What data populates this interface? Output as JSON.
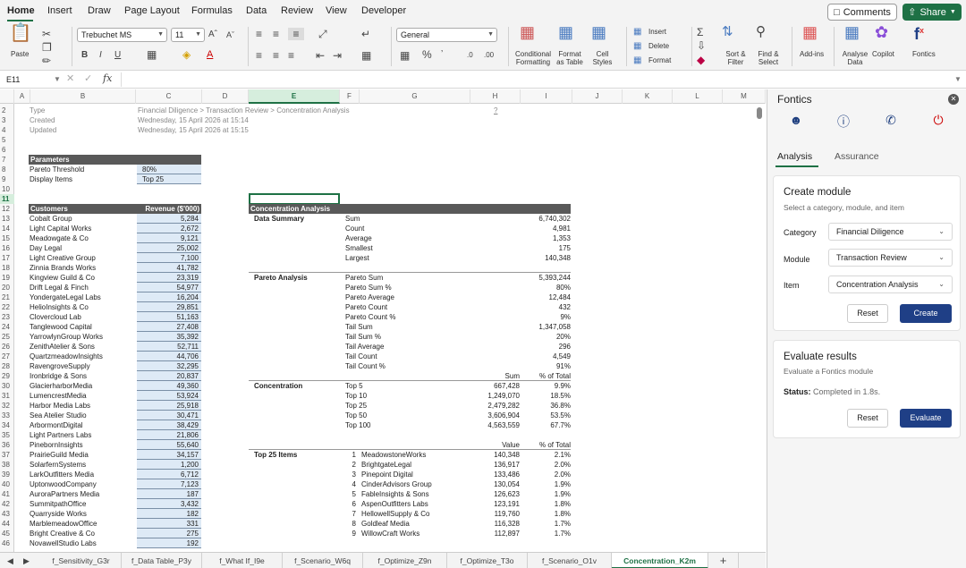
{
  "menu": {
    "items": [
      "Home",
      "Insert",
      "Draw",
      "Page Layout",
      "Formulas",
      "Data",
      "Review",
      "View",
      "Developer"
    ],
    "comments": "Comments",
    "share": "Share"
  },
  "ribbon": {
    "paste": "Paste",
    "font_name": "Trebuchet MS",
    "font_size": "11",
    "number_format": "General",
    "insert": "Insert",
    "delete": "Delete",
    "format": "Format",
    "conditional_formatting": "Conditional Formatting",
    "format_as_table": "Format as Table",
    "cell_styles": "Cell Styles",
    "sort_filter": "Sort & Filter",
    "find_select": "Find & Select",
    "add_ins": "Add-ins",
    "analyse_data": "Analyse Data",
    "copilot": "Copilot",
    "fontics": "Fontics"
  },
  "formula_bar": {
    "name_box": "E11",
    "fx": "fx",
    "value": ""
  },
  "columns": [
    "A",
    "B",
    "C",
    "D",
    "E",
    "F",
    "G",
    "H",
    "I",
    "J",
    "K",
    "L",
    "M"
  ],
  "selected_cell": "E11",
  "rows": [
    "2",
    "3",
    "4",
    "5",
    "6",
    "7",
    "8",
    "9",
    "10",
    "11",
    "12",
    "13",
    "14",
    "15",
    "16",
    "17",
    "18",
    "19",
    "20",
    "21",
    "22",
    "23",
    "24",
    "25",
    "26",
    "27",
    "28",
    "29",
    "30",
    "31",
    "32",
    "33",
    "34",
    "35",
    "36",
    "37",
    "38",
    "39",
    "40",
    "41",
    "42",
    "43",
    "44",
    "45",
    "46"
  ],
  "meta": {
    "type_label": "Type",
    "type_value": "Financial Diligence > Transaction Review > Concentration Analysis",
    "created_label": "Created",
    "created_value": "Wednesday, 15 April 2026 at 15:14",
    "updated_label": "Updated",
    "updated_value": "Wednesday, 15 April 2026 at 15:15",
    "help": "?"
  },
  "parameters": {
    "header": "Parameters",
    "rows": [
      {
        "label": "Pareto Threshold",
        "value": "80%"
      },
      {
        "label": "Display Items",
        "value": "Top 25"
      }
    ]
  },
  "customers": {
    "header": "Customers",
    "value_header": "Revenue ($'000)",
    "rows": [
      {
        "name": "Cobalt Group",
        "value": "5,284"
      },
      {
        "name": "Light Capital Works",
        "value": "2,672"
      },
      {
        "name": "Meadowgate & Co",
        "value": "9,121"
      },
      {
        "name": "Day Legal",
        "value": "25,002"
      },
      {
        "name": "Light Creative Group",
        "value": "7,100"
      },
      {
        "name": "Zinnia Brands Works",
        "value": "41,782"
      },
      {
        "name": "Kingview Guild & Co",
        "value": "23,319"
      },
      {
        "name": "Drift Legal & Finch",
        "value": "54,977"
      },
      {
        "name": "YondergateLegal Labs",
        "value": "16,204"
      },
      {
        "name": "HelioInsights & Co",
        "value": "29,851"
      },
      {
        "name": "Clovercloud Lab",
        "value": "51,163"
      },
      {
        "name": "Tanglewood Capital",
        "value": "27,408"
      },
      {
        "name": "YarrowlynGroup Works",
        "value": "35,392"
      },
      {
        "name": "ZenithAtelier & Sons",
        "value": "52,711"
      },
      {
        "name": "QuartzmeadowInsights",
        "value": "44,706"
      },
      {
        "name": "RavengroveSupply",
        "value": "32,295"
      },
      {
        "name": "Ironbridge & Sons",
        "value": "20,837"
      },
      {
        "name": "GlacierharborMedia",
        "value": "49,360"
      },
      {
        "name": "LumencrestMedia",
        "value": "53,924"
      },
      {
        "name": "Harbor Media Labs",
        "value": "25,918"
      },
      {
        "name": "Sea Atelier Studio",
        "value": "30,471"
      },
      {
        "name": "ArbormontDigital",
        "value": "38,429"
      },
      {
        "name": "Light Partners Labs",
        "value": "21,806"
      },
      {
        "name": "PinebornInsights",
        "value": "55,640"
      },
      {
        "name": "PrairieGuild Media",
        "value": "34,157"
      },
      {
        "name": "SolarfernSystems",
        "value": "1,200"
      },
      {
        "name": "LarkOutfitters Media",
        "value": "6,712"
      },
      {
        "name": "UptonwoodCompany",
        "value": "7,123"
      },
      {
        "name": "AuroraPartners Media",
        "value": "187"
      },
      {
        "name": "SummitpathOffice",
        "value": "3,432"
      },
      {
        "name": "Quarryside Works",
        "value": "182"
      },
      {
        "name": "MarblemeadowOffice",
        "value": "331"
      },
      {
        "name": "Bright Creative & Co",
        "value": "275"
      },
      {
        "name": "NovawellStudio Labs",
        "value": "192"
      }
    ]
  },
  "analysis": {
    "header": "Concentration Analysis",
    "data_summary": {
      "title": "Data Summary",
      "rows": [
        {
          "label": "Sum",
          "value": "6,740,302"
        },
        {
          "label": "Count",
          "value": "4,981"
        },
        {
          "label": "Average",
          "value": "1,353"
        },
        {
          "label": "Smallest",
          "value": "175"
        },
        {
          "label": "Largest",
          "value": "140,348"
        }
      ]
    },
    "pareto": {
      "title": "Pareto Analysis",
      "rows": [
        {
          "label": "Pareto Sum",
          "value": "5,393,244"
        },
        {
          "label": "Pareto Sum %",
          "value": "80%"
        },
        {
          "label": "Pareto Average",
          "value": "12,484"
        },
        {
          "label": "Pareto Count",
          "value": "432"
        },
        {
          "label": "Pareto Count %",
          "value": "9%"
        },
        {
          "label": "Tail Sum",
          "value": "1,347,058"
        },
        {
          "label": "Tail Sum %",
          "value": "20%"
        },
        {
          "label": "Tail Average",
          "value": "296"
        },
        {
          "label": "Tail Count",
          "value": "4,549"
        },
        {
          "label": "Tail Count %",
          "value": "91%"
        }
      ]
    },
    "concentration": {
      "title": "Concentration",
      "sum_header": "Sum",
      "pct_header": "% of Total",
      "rows": [
        {
          "label": "Top 5",
          "sum": "667,428",
          "pct": "9.9%"
        },
        {
          "label": "Top 10",
          "sum": "1,249,070",
          "pct": "18.5%"
        },
        {
          "label": "Top 25",
          "sum": "2,479,282",
          "pct": "36.8%"
        },
        {
          "label": "Top 50",
          "sum": "3,606,904",
          "pct": "53.5%"
        },
        {
          "label": "Top 100",
          "sum": "4,563,559",
          "pct": "67.7%"
        }
      ]
    },
    "top_items": {
      "title": "Top 25 Items",
      "value_header": "Value",
      "pct_header": "% of Total",
      "rows": [
        {
          "rank": "1",
          "name": "MeadowstoneWorks",
          "value": "140,348",
          "pct": "2.1%"
        },
        {
          "rank": "2",
          "name": "BrightgateLegal",
          "value": "136,917",
          "pct": "2.0%"
        },
        {
          "rank": "3",
          "name": "Pinepoint Digital",
          "value": "133,486",
          "pct": "2.0%"
        },
        {
          "rank": "4",
          "name": "CinderAdvisors Group",
          "value": "130,054",
          "pct": "1.9%"
        },
        {
          "rank": "5",
          "name": "FableInsights & Sons",
          "value": "126,623",
          "pct": "1.9%"
        },
        {
          "rank": "6",
          "name": "AspenOutfitters Labs",
          "value": "123,191",
          "pct": "1.8%"
        },
        {
          "rank": "7",
          "name": "HellowellSupply & Co",
          "value": "119,760",
          "pct": "1.8%"
        },
        {
          "rank": "8",
          "name": "Goldleaf Media",
          "value": "116,328",
          "pct": "1.7%"
        },
        {
          "rank": "9",
          "name": "WillowCraft Works",
          "value": "112,897",
          "pct": "1.7%"
        }
      ]
    }
  },
  "sheet_tabs": {
    "items": [
      "f_Sensitivity_G3r",
      "f_Data Table_P3y",
      "f_What If_I9e",
      "f_Scenario_W6q",
      "f_Optimize_Z9n",
      "f_Optimize_T3o",
      "f_Scenario_O1v",
      "Concentration_K2m"
    ],
    "active": "Concentration_K2m",
    "add": "+"
  },
  "pane": {
    "title": "Fontics",
    "tabs": [
      "Analysis",
      "Assurance"
    ],
    "active_tab": "Analysis",
    "create": {
      "title": "Create module",
      "subtitle": "Select a category, module, and item",
      "category_label": "Category",
      "category_value": "Financial Diligence",
      "module_label": "Module",
      "module_value": "Transaction Review",
      "item_label": "Item",
      "item_value": "Concentration Analysis",
      "reset": "Reset",
      "create": "Create"
    },
    "evaluate": {
      "title": "Evaluate results",
      "subtitle": "Evaluate a Fontics module",
      "status_label": "Status:",
      "status_value": "Completed in 1.8s.",
      "reset": "Reset",
      "evaluate": "Evaluate"
    }
  },
  "colors": {
    "accent": "#1e7145",
    "primary_button": "#1f3f86",
    "header_fill": "#595959",
    "input_fill": "#deeaf6"
  }
}
